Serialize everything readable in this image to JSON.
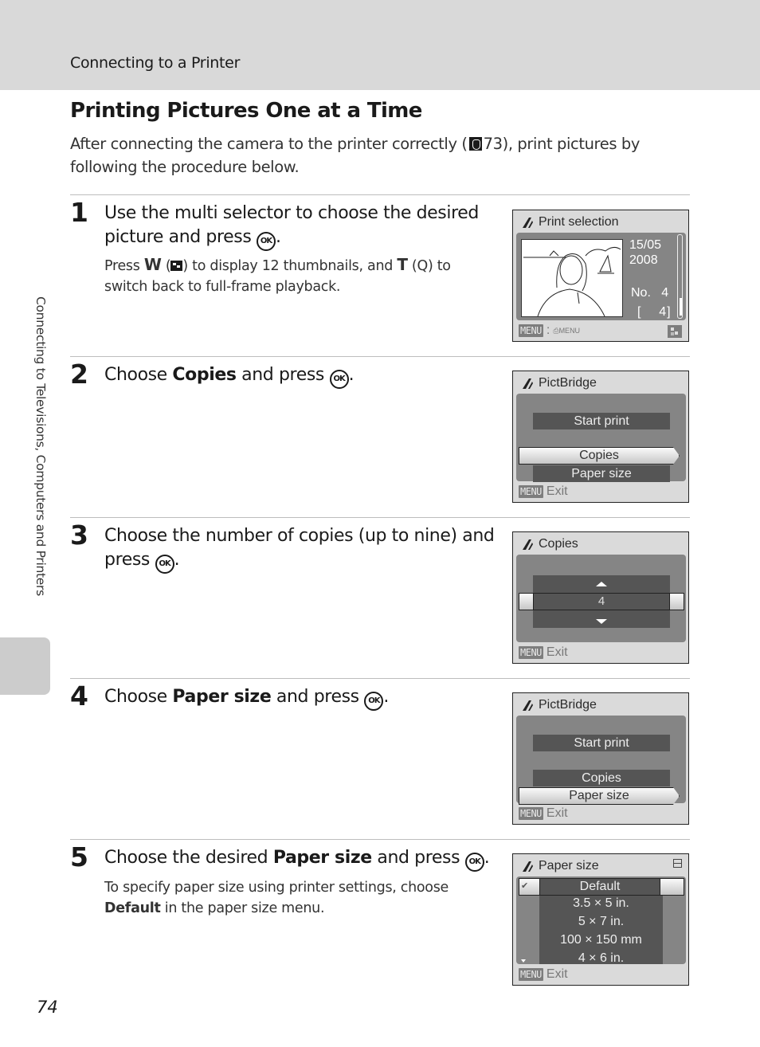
{
  "header": {
    "running_head": "Connecting to a Printer"
  },
  "page": {
    "title": "Printing Pictures One at a Time",
    "intro_before": "After connecting the camera to the printer correctly (",
    "intro_ref": "73",
    "intro_after": "), print pictures by following the procedure below.",
    "side_tab": "Connecting to Televisions, Computers and Printers",
    "page_number": "74"
  },
  "icons": {
    "reference": "reference-icon",
    "ok": "ok-button-icon",
    "ok_label": "OK",
    "thumbnail": "thumbnail-playback-icon",
    "zoom": "playback-zoom-icon",
    "zoom_glyph": "Q"
  },
  "steps": [
    {
      "number": "1",
      "text_parts": [
        "Use the multi selector to choose the desired picture and press ",
        "."
      ],
      "sub_parts": [
        "Press ",
        "W",
        " (",
        ") to display 12 thumbnails, and ",
        "T",
        " (",
        ") to switch back to full-frame playback."
      ],
      "screen": {
        "title": "Print selection",
        "date_line1": "15/05",
        "date_line2": "2008",
        "no_label": "No.",
        "no_value": "4",
        "count_open": "[",
        "count_value": "4]",
        "footer_menu": "MENU",
        "footer_sep": ":",
        "footer_print_menu": "MENU"
      }
    },
    {
      "number": "2",
      "text_pre": "Choose ",
      "text_bold": "Copies",
      "text_post": " and press ",
      "text_end": ".",
      "screen": {
        "title": "PictBridge",
        "items": [
          "Start print",
          "Copies",
          "Paper size"
        ],
        "selected": "Copies",
        "footer_menu": "MENU",
        "footer_label": "Exit"
      }
    },
    {
      "number": "3",
      "text_pre": "Choose the number of copies (up to nine) and press ",
      "text_end": ".",
      "screen": {
        "title": "Copies",
        "value": "4",
        "footer_menu": "MENU",
        "footer_label": "Exit"
      }
    },
    {
      "number": "4",
      "text_pre": "Choose ",
      "text_bold": "Paper size",
      "text_post": " and press ",
      "text_end": ".",
      "screen": {
        "title": "PictBridge",
        "items": [
          "Start print",
          "Copies",
          "Paper size"
        ],
        "selected": "Paper size",
        "footer_menu": "MENU",
        "footer_label": "Exit"
      }
    },
    {
      "number": "5",
      "text_pre": "Choose the desired ",
      "text_bold": "Paper size",
      "text_post": " and press ",
      "text_end": ".",
      "sub_pre": "To specify paper size using printer settings, choose ",
      "sub_bold": "Default",
      "sub_post": " in the paper size menu.",
      "screen": {
        "title": "Paper size",
        "options": [
          "Default",
          "3.5 × 5 in.",
          "5 × 7 in.",
          "100 × 150 mm",
          "4 × 6 in."
        ],
        "selected": "Default",
        "check_glyph": "✔",
        "footer_menu": "MENU",
        "footer_label": "Exit"
      }
    }
  ]
}
